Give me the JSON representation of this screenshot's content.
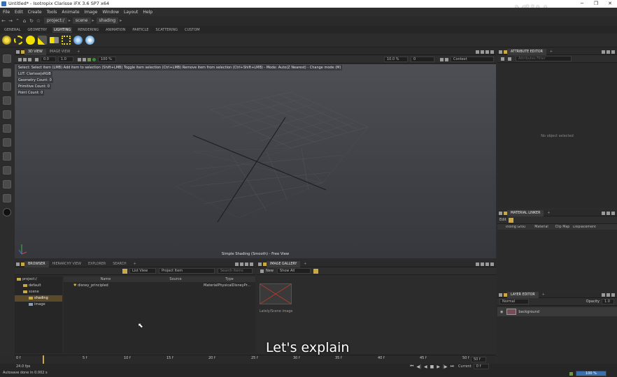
{
  "window": {
    "title": "Untitled* - Isotropix Clarisse iFX 3.6 SP7 x64",
    "min_glyph": "─",
    "max_glyph": "❐",
    "close_glyph": "✕"
  },
  "watermark": "YiiHuu.com",
  "menu": [
    "File",
    "Edit",
    "Create",
    "Tools",
    "Animate",
    "Image",
    "Window",
    "Layout",
    "Help"
  ],
  "path": {
    "back": "←",
    "forward": "→",
    "crumbs": [
      "project:/",
      "scene",
      "shading"
    ],
    "sep": "▸"
  },
  "shelf_tabs": [
    "GENERAL",
    "GEOMETRY",
    "LIGHTING",
    "RENDERING",
    "ANIMATION",
    "PARTICLE",
    "SCATTERING",
    "CUSTOM"
  ],
  "shelf_active": "LIGHTING",
  "viewport": {
    "tabs": [
      "3D VIEW",
      "IMAGE VIEW"
    ],
    "add_tab": "+",
    "fields": {
      "a": "0.0",
      "b": "1.0",
      "zoom": "100 %",
      "c": "10.0 %",
      "d": "0",
      "context": "Context"
    },
    "hint": "Select: Select item (LMB)  Add item to selection (Shift+LMB)  Toggle item selection (Ctrl+LMB)  Remove item from selection (Ctrl+Shift+LMB)  - Mode: Auto(Z Nearest) - Change mode (M)",
    "stats": [
      "LUT: Clarisse|sRGB",
      "Geometry Count: 0",
      "Primitive Count: 0",
      "Point Count: 0"
    ],
    "footer": "Simple Shading (Smooth) - Free View"
  },
  "browser": {
    "tabs": [
      "BROWSER",
      "HIERARCHY VIEW",
      "EXPLORER",
      "SEARCH"
    ],
    "add_tab": "+",
    "view_mode": "List View",
    "filter": "Project Item",
    "search_placeholder": "Search Items",
    "tree": [
      {
        "label": "project:/",
        "indent": 0
      },
      {
        "label": "default",
        "indent": 1
      },
      {
        "label": "scene",
        "indent": 1
      },
      {
        "label": "shading",
        "indent": 2,
        "selected": true
      },
      {
        "label": "image",
        "indent": 2
      }
    ],
    "columns": [
      "Name",
      "Source",
      "Type"
    ],
    "rows": [
      {
        "name": "disney_principled",
        "source": "",
        "type": "MaterialPhysicalDisneyPr..."
      }
    ]
  },
  "gallery": {
    "tab": "IMAGE GALLERY",
    "add_tab": "+",
    "new_label": "New",
    "show": "Show All",
    "item_label": "Lately/Scene image"
  },
  "timeline": {
    "ticks": [
      "0 f",
      "5 f",
      "10 f",
      "15 f",
      "20 f",
      "25 f",
      "30 f",
      "35 f",
      "40 f",
      "45 f",
      "50 f"
    ],
    "end": "50 f",
    "fps": "24.0 fps",
    "current_label": "Current",
    "current_value": "0 f",
    "transport": [
      "⏮",
      "◀|",
      "◀",
      "■",
      "▶",
      "|▶",
      "⏭"
    ]
  },
  "status": {
    "message": "Autosave done in 0.002 s",
    "zoom": "100 %"
  },
  "attribute_editor": {
    "tab": "ATTRIBUTE EDITOR",
    "filter_placeholder": "Attributes Filter",
    "empty": "No object selected"
  },
  "material_linker": {
    "tab": "MATERIAL LINKER",
    "edit": "Edit",
    "columns": [
      "Inding Grou",
      "Material",
      "Clip Map",
      "Displacement"
    ],
    "add_tab": "+"
  },
  "layer_editor": {
    "tab": "LAYER EDITOR",
    "blend": "Normal",
    "opacity_label": "Opacity",
    "opacity_value": "1.0",
    "layers": [
      "background"
    ],
    "add_tab": "+"
  },
  "subtitle": "Let's explain",
  "colors": {
    "accent": "#c9a84a",
    "yellow_light": "#f2e100",
    "viewport_top": "#4d4f55",
    "selection": "#5a4a2a"
  }
}
